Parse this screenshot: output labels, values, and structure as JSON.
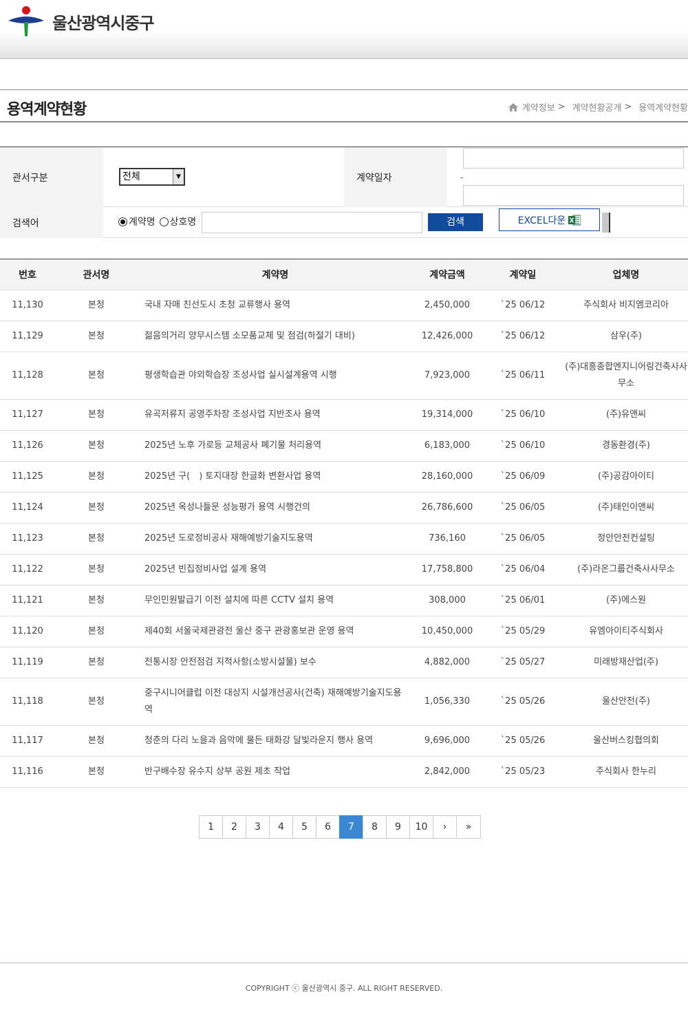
{
  "header": {
    "site_name": "울산광역시중구",
    "logo_colors": {
      "red": "#d7131b",
      "blue": "#1b3d8f",
      "green": "#1e9a3c"
    }
  },
  "page": {
    "title": "용역계약현황",
    "breadcrumb": [
      "계약정보",
      "계약현황공개",
      "용역계약현황"
    ],
    "breadcrumb_sep": ">"
  },
  "search": {
    "dept_label": "관서구분",
    "dept_selected": "전체",
    "date_label": "계약일자",
    "date_sep": "-",
    "keyword_label": "검색어",
    "radio_contract": "계약명",
    "radio_company": "상호명",
    "search_button": "검색",
    "excel_button": "EXCEL다운",
    "accent_color": "#124a9c"
  },
  "table": {
    "headers": [
      "번호",
      "관서명",
      "계약명",
      "계약금액",
      "계약일",
      "업체명"
    ],
    "rows": [
      {
        "no": "11,130",
        "dept": "본청",
        "name": "국내 자매 친선도시 초청 교류행사 용역",
        "amount": "2,450,000",
        "date": "`25 06/12",
        "company": "주식회사 비지엠코리아"
      },
      {
        "no": "11,129",
        "dept": "본청",
        "name": "젊음의거리 양무시스템 소모품교체 및 점검(하절기 대비)",
        "amount": "12,426,000",
        "date": "`25 06/12",
        "company": "삼우(주)"
      },
      {
        "no": "11,128",
        "dept": "본청",
        "name": "평생학습관 야외학습장 조성사업 실시설계용역 시행",
        "amount": "7,923,000",
        "date": "`25 06/11",
        "company": "(주)대흥종합엔지니어링건축사사무소"
      },
      {
        "no": "11,127",
        "dept": "본청",
        "name": "유곡저류지 공영주차장 조성사업 지반조사 용역",
        "amount": "19,314,000",
        "date": "`25 06/10",
        "company": "(주)유앤씨"
      },
      {
        "no": "11,126",
        "dept": "본청",
        "name": "2025년 노후 가로등 교체공사 폐기물 처리용역",
        "amount": "6,183,000",
        "date": "`25 06/10",
        "company": "경동환경(주)"
      },
      {
        "no": "11,125",
        "dept": "본청",
        "name": "2025년 구(　) 토지대장 한글화 변환사업 용역",
        "amount": "28,160,000",
        "date": "`25 06/09",
        "company": "(주)공감아이티"
      },
      {
        "no": "11,124",
        "dept": "본청",
        "name": "2025년 옥성나들문 성능평가 용역 시행건의",
        "amount": "26,786,600",
        "date": "`25 06/05",
        "company": "(주)태인이앤씨"
      },
      {
        "no": "11,123",
        "dept": "본청",
        "name": "2025년 도로정비공사 재해예방기술지도용역",
        "amount": "736,160",
        "date": "`25 06/05",
        "company": "정안안전컨설팅"
      },
      {
        "no": "11,122",
        "dept": "본청",
        "name": "2025년 빈집정비사업 설계 용역",
        "amount": "17,758,800",
        "date": "`25 06/04",
        "company": "(주)라온그룹건축사사무소"
      },
      {
        "no": "11,121",
        "dept": "본청",
        "name": "무인민원발급기 이전 설치에 따른 CCTV 설치 용역",
        "amount": "308,000",
        "date": "`25 06/01",
        "company": "(주)에스원"
      },
      {
        "no": "11,120",
        "dept": "본청",
        "name": "제40회 서울국제관광전 울산 중구 관광홍보관 운영 용역",
        "amount": "10,450,000",
        "date": "`25 05/29",
        "company": "유엠아이티주식회사"
      },
      {
        "no": "11,119",
        "dept": "본청",
        "name": "전통시장 안전점검 지적사항(소방시설물) 보수",
        "amount": "4,882,000",
        "date": "`25 05/27",
        "company": "미래방재산업(주)"
      },
      {
        "no": "11,118",
        "dept": "본청",
        "name": "중구시니어클럽 이전 대상지 시설개선공사(건축) 재해예방기술지도용역",
        "amount": "1,056,330",
        "date": "`25 05/26",
        "company": "울산안전(주)"
      },
      {
        "no": "11,117",
        "dept": "본청",
        "name": "청춘의 다리 노을과 음악에 물든 태화강 달빛라운지 행사 용역",
        "amount": "9,696,000",
        "date": "`25 05/26",
        "company": "울산버스킹협의회"
      },
      {
        "no": "11,116",
        "dept": "본청",
        "name": "반구배수장 유수지 상부 공원 제초 작업",
        "amount": "2,842,000",
        "date": "`25 05/23",
        "company": "주식회사 한누리"
      }
    ]
  },
  "pagination": {
    "pages": [
      "1",
      "2",
      "3",
      "4",
      "5",
      "6",
      "7",
      "8",
      "9",
      "10"
    ],
    "current": "7",
    "next": "›",
    "last": "»",
    "active_color": "#3a87d4"
  },
  "footer": {
    "copyright": "COPYRIGHT ⓒ 울산광역시 중구. ALL RIGHT RESERVED."
  }
}
